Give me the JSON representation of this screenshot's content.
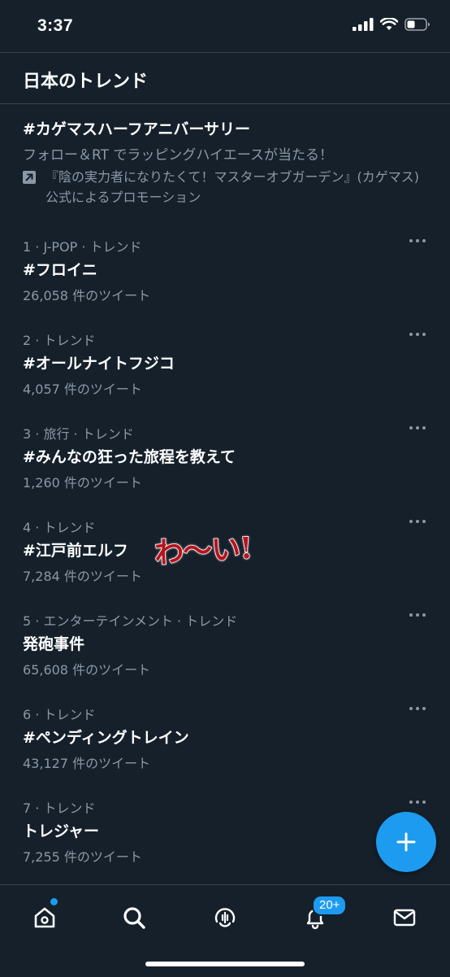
{
  "status_bar": {
    "time": "3:37"
  },
  "header": {
    "title": "日本のトレンド"
  },
  "promoted": {
    "title": "#カゲマスハーフアニバーサリー",
    "description": "フォロー＆RT でラッピングハイエースが当たる！",
    "promoted_by": "『陰の実力者になりたくて！マスターオブガーデン』(カゲマス) 公式によるプロモーション"
  },
  "trends": [
    {
      "meta": "1 · J-POP · トレンド",
      "name": "#フロイニ",
      "count": "26,058 件のツイート"
    },
    {
      "meta": "2 · トレンド",
      "name": "#オールナイトフジコ",
      "count": "4,057 件のツイート"
    },
    {
      "meta": "3 · 旅行 · トレンド",
      "name": "#みんなの狂った旅程を教えて",
      "count": "1,260 件のツイート"
    },
    {
      "meta": "4 · トレンド",
      "name": "#江戸前エルフ",
      "count": "7,284 件のツイート"
    },
    {
      "meta": "5 · エンターテインメント · トレンド",
      "name": "発砲事件",
      "count": "65,608 件のツイート"
    },
    {
      "meta": "6 · トレンド",
      "name": "#ペンディングトレイン",
      "count": "43,127 件のツイート"
    },
    {
      "meta": "7 · トレンド",
      "name": "トレジャー",
      "count": "7,255 件のツイート"
    }
  ],
  "sticker": {
    "text": "わ〜い!"
  },
  "tab_bar": {
    "tabs": [
      {
        "icon": "home-icon",
        "active": true
      },
      {
        "icon": "search-icon",
        "active": false
      },
      {
        "icon": "spaces-icon",
        "active": false
      },
      {
        "icon": "bell-icon",
        "active": false
      },
      {
        "icon": "mail-icon",
        "active": false
      }
    ],
    "notifications_badge": "20+"
  },
  "colors": {
    "background": "#15202b",
    "text_primary": "#ffffff",
    "text_secondary": "#8b98a5",
    "divider": "#38444d",
    "accent": "#1d9bf0"
  }
}
